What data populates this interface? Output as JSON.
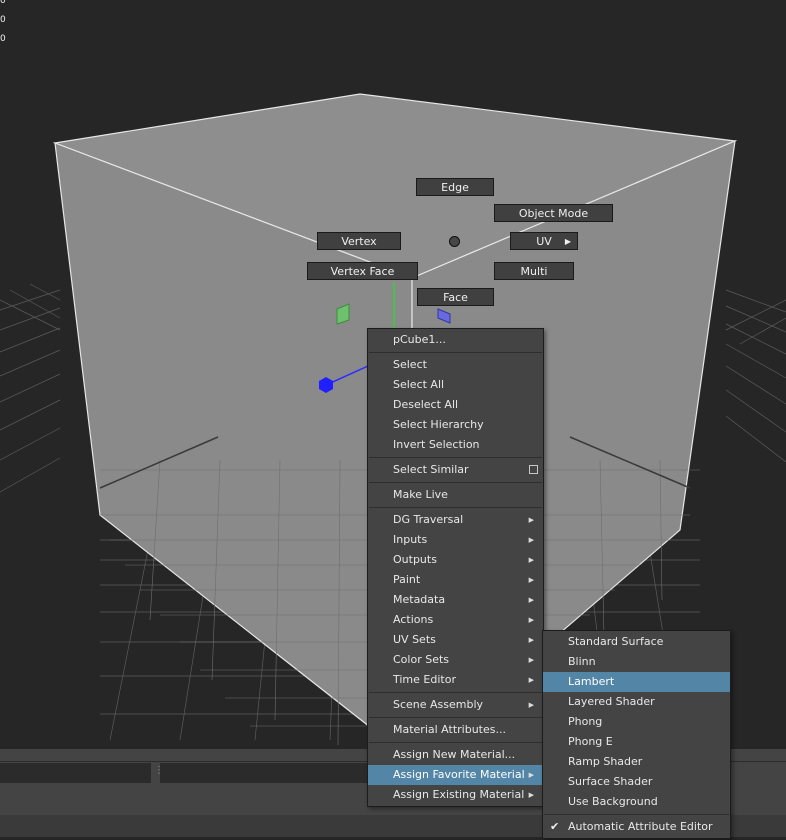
{
  "hud": {
    "values": [
      "0",
      "0",
      "0"
    ]
  },
  "marking_menu": {
    "edge": "Edge",
    "object_mode": "Object Mode",
    "vertex": "Vertex",
    "uv": "UV",
    "vertex_face": "Vertex Face",
    "multi": "Multi",
    "face": "Face"
  },
  "context_menu": {
    "object": "pCube1...",
    "select": "Select",
    "select_all": "Select All",
    "deselect_all": "Deselect All",
    "select_hierarchy": "Select Hierarchy",
    "invert_selection": "Invert Selection",
    "select_similar": "Select Similar",
    "make_live": "Make Live",
    "dg_traversal": "DG Traversal",
    "inputs": "Inputs",
    "outputs": "Outputs",
    "paint": "Paint",
    "metadata": "Metadata",
    "actions": "Actions",
    "uv_sets": "UV Sets",
    "color_sets": "Color Sets",
    "time_editor": "Time Editor",
    "scene_assembly": "Scene Assembly",
    "material_attributes": "Material Attributes...",
    "assign_new_material": "Assign New Material...",
    "assign_favorite_material": "Assign Favorite Material",
    "assign_existing_material": "Assign Existing Material"
  },
  "material_submenu": {
    "items": [
      "Standard Surface",
      "Blinn",
      "Lambert",
      "Layered Shader",
      "Phong",
      "Phong E",
      "Ramp Shader",
      "Surface Shader",
      "Use Background"
    ],
    "highlighted": "Lambert",
    "auto_attr_editor": "Automatic Attribute Editor"
  },
  "colors": {
    "viewport_bg": "#262626",
    "cube_face": "#8c8c8c",
    "menu_bg": "#444444",
    "highlight": "#5285a6"
  }
}
